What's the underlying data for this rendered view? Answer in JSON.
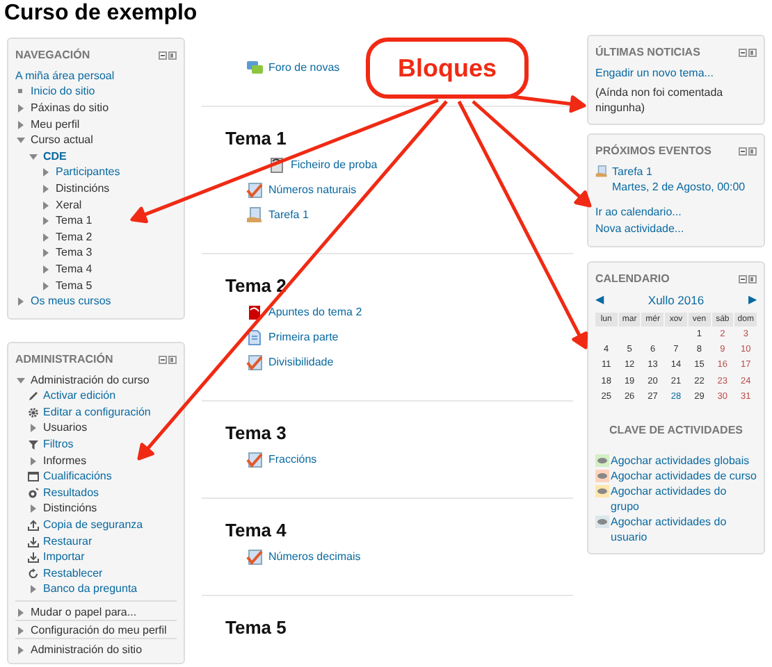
{
  "page_title": "Curso de exemplo",
  "navigation": {
    "title": "NAVEGACIÓN",
    "items": [
      {
        "label": "A miña área persoal",
        "kind": "none",
        "link": true,
        "active": false,
        "children": [
          {
            "label": "Inicio do sitio",
            "kind": "bullet",
            "link": true,
            "active": false
          },
          {
            "label": "Páxinas do sitio",
            "kind": "collapsed",
            "link": false,
            "active": false
          },
          {
            "label": "Meu perfil",
            "kind": "collapsed",
            "link": false,
            "active": false
          },
          {
            "label": "Curso actual",
            "kind": "expanded",
            "link": false,
            "active": false,
            "children": [
              {
                "label": "CDE",
                "kind": "expanded",
                "link": true,
                "active": true,
                "children": [
                  {
                    "label": "Participantes",
                    "kind": "collapsed",
                    "link": true,
                    "active": false
                  },
                  {
                    "label": "Distincións",
                    "kind": "collapsed",
                    "link": false,
                    "active": false
                  },
                  {
                    "label": "Xeral",
                    "kind": "collapsed",
                    "link": false,
                    "active": false
                  },
                  {
                    "label": "Tema 1",
                    "kind": "collapsed",
                    "link": false,
                    "active": false
                  },
                  {
                    "label": "Tema 2",
                    "kind": "collapsed",
                    "link": false,
                    "active": false
                  },
                  {
                    "label": "Tema 3",
                    "kind": "collapsed",
                    "link": false,
                    "active": false
                  },
                  {
                    "label": "Tema 4",
                    "kind": "collapsed",
                    "link": false,
                    "active": false
                  },
                  {
                    "label": "Tema 5",
                    "kind": "collapsed",
                    "link": false,
                    "active": false
                  }
                ]
              }
            ]
          },
          {
            "label": "Os meus cursos",
            "kind": "collapsed",
            "link": true,
            "active": false
          }
        ]
      }
    ]
  },
  "administration": {
    "title": "ADMINISTRACIÓN",
    "items": [
      {
        "label": "Administración do curso",
        "kind": "expanded",
        "link": false,
        "active": false,
        "children": [
          {
            "label": "Activar edición",
            "kind": "pencil",
            "link": true,
            "active": false
          },
          {
            "label": "Editar a configuración",
            "kind": "gear",
            "link": true,
            "active": false
          },
          {
            "label": "Usuarios",
            "kind": "collapsed",
            "link": false,
            "active": false
          },
          {
            "label": "Filtros",
            "kind": "filter",
            "link": true,
            "active": false
          },
          {
            "label": "Informes",
            "kind": "collapsed",
            "link": false,
            "active": false
          },
          {
            "label": "Cualificacións",
            "kind": "table",
            "link": true,
            "active": false
          },
          {
            "label": "Resultados",
            "kind": "medal",
            "link": true,
            "active": false
          },
          {
            "label": "Distincións",
            "kind": "collapsed",
            "link": false,
            "active": false
          },
          {
            "label": "Copia de seguranza",
            "kind": "upload",
            "link": true,
            "active": false
          },
          {
            "label": "Restaurar",
            "kind": "download",
            "link": true,
            "active": false
          },
          {
            "label": "Importar",
            "kind": "download",
            "link": true,
            "active": false
          },
          {
            "label": "Restablecer",
            "kind": "reset",
            "link": true,
            "active": false
          },
          {
            "label": "Banco da pregunta",
            "kind": "collapsed",
            "link": true,
            "active": false
          }
        ]
      },
      {
        "label": "Mudar o papel para...",
        "kind": "collapsed",
        "link": false,
        "active": false
      },
      {
        "label": "Configuración do meu perfil",
        "kind": "collapsed",
        "link": false,
        "active": false
      },
      {
        "label": "Administración do sitio",
        "kind": "collapsed",
        "link": false,
        "active": false
      }
    ]
  },
  "sections": [
    {
      "activities": [
        {
          "label": "Foro de novas",
          "kind": "forum",
          "indented": false
        }
      ]
    },
    {
      "heading": "Tema 1",
      "activities": [
        {
          "label": "Ficheiro de proba",
          "kind": "file",
          "indented": true
        },
        {
          "label": "Números naturais",
          "kind": "quiz",
          "indented": false
        },
        {
          "label": "Tarefa 1",
          "kind": "assign",
          "indented": false
        }
      ]
    },
    {
      "heading": "Tema 2",
      "activities": [
        {
          "label": "Apuntes do tema 2",
          "kind": "pdf",
          "indented": false
        },
        {
          "label": "Primeira parte",
          "kind": "page",
          "indented": false
        },
        {
          "label": "Divisibilidade",
          "kind": "quiz",
          "indented": false
        }
      ]
    },
    {
      "heading": "Tema 3",
      "activities": [
        {
          "label": "Fraccións",
          "kind": "quiz",
          "indented": false
        }
      ]
    },
    {
      "heading": "Tema 4",
      "activities": [
        {
          "label": "Números decimais",
          "kind": "quiz",
          "indented": false
        }
      ]
    },
    {
      "heading": "Tema 5"
    }
  ],
  "latest_news": {
    "title": "ÚLTIMAS NOTICIAS",
    "link": "Engadir un novo tema...",
    "note": "(Aínda non foi comentada ningunha)"
  },
  "upcoming_events": {
    "title": "PRÓXIMOS EVENTOS",
    "event": {
      "name": "Tarefa 1",
      "date": "Martes, 2 de Agosto, 00:00"
    },
    "links": [
      "Ir ao calendario...",
      "Nova actividade..."
    ]
  },
  "calendar": {
    "title": "CALENDARIO",
    "prev": "◀",
    "month": "Xullo 2016",
    "next": "▶",
    "weekdays": [
      "lun",
      "mar",
      "mér",
      "xov",
      "ven",
      "sáb",
      "dom"
    ],
    "weeks": [
      [
        {
          "kind": "blank"
        },
        {
          "kind": "blank"
        },
        {
          "kind": "blank"
        },
        {
          "kind": "blank"
        },
        {
          "day": "1",
          "kind": "weekday"
        },
        {
          "day": "2",
          "kind": "weekend"
        },
        {
          "day": "3",
          "kind": "weekend"
        }
      ],
      [
        {
          "day": "4",
          "kind": "weekday"
        },
        {
          "day": "5",
          "kind": "weekday"
        },
        {
          "day": "6",
          "kind": "weekday"
        },
        {
          "day": "7",
          "kind": "weekday"
        },
        {
          "day": "8",
          "kind": "weekday"
        },
        {
          "day": "9",
          "kind": "weekend"
        },
        {
          "day": "10",
          "kind": "weekend"
        }
      ],
      [
        {
          "day": "11",
          "kind": "weekday"
        },
        {
          "day": "12",
          "kind": "weekday"
        },
        {
          "day": "13",
          "kind": "weekday"
        },
        {
          "day": "14",
          "kind": "weekday"
        },
        {
          "day": "15",
          "kind": "weekday"
        },
        {
          "day": "16",
          "kind": "weekend"
        },
        {
          "day": "17",
          "kind": "weekend"
        }
      ],
      [
        {
          "day": "18",
          "kind": "weekday"
        },
        {
          "day": "19",
          "kind": "weekday"
        },
        {
          "day": "20",
          "kind": "weekday"
        },
        {
          "day": "21",
          "kind": "weekday"
        },
        {
          "day": "22",
          "kind": "weekday"
        },
        {
          "day": "23",
          "kind": "weekend"
        },
        {
          "day": "24",
          "kind": "weekend"
        }
      ],
      [
        {
          "day": "25",
          "kind": "weekday"
        },
        {
          "day": "26",
          "kind": "weekday"
        },
        {
          "day": "27",
          "kind": "weekday"
        },
        {
          "day": "28",
          "kind": "today"
        },
        {
          "day": "29",
          "kind": "weekday"
        },
        {
          "day": "30",
          "kind": "weekend"
        },
        {
          "day": "31",
          "kind": "weekend"
        }
      ]
    ],
    "key_title": "CLAVE DE ACTIVIDADES",
    "key": [
      {
        "label": "Agochar actividades globais",
        "color": "#d3efc6"
      },
      {
        "label": "Agochar actividades de curso",
        "color": "#ffd3bd"
      },
      {
        "label": "Agochar actividades do grupo",
        "color": "#fee7ae"
      },
      {
        "label": "Agochar actividades do usuario",
        "color": "#dce7ec"
      }
    ]
  },
  "annotation": {
    "label": "Bloques"
  }
}
